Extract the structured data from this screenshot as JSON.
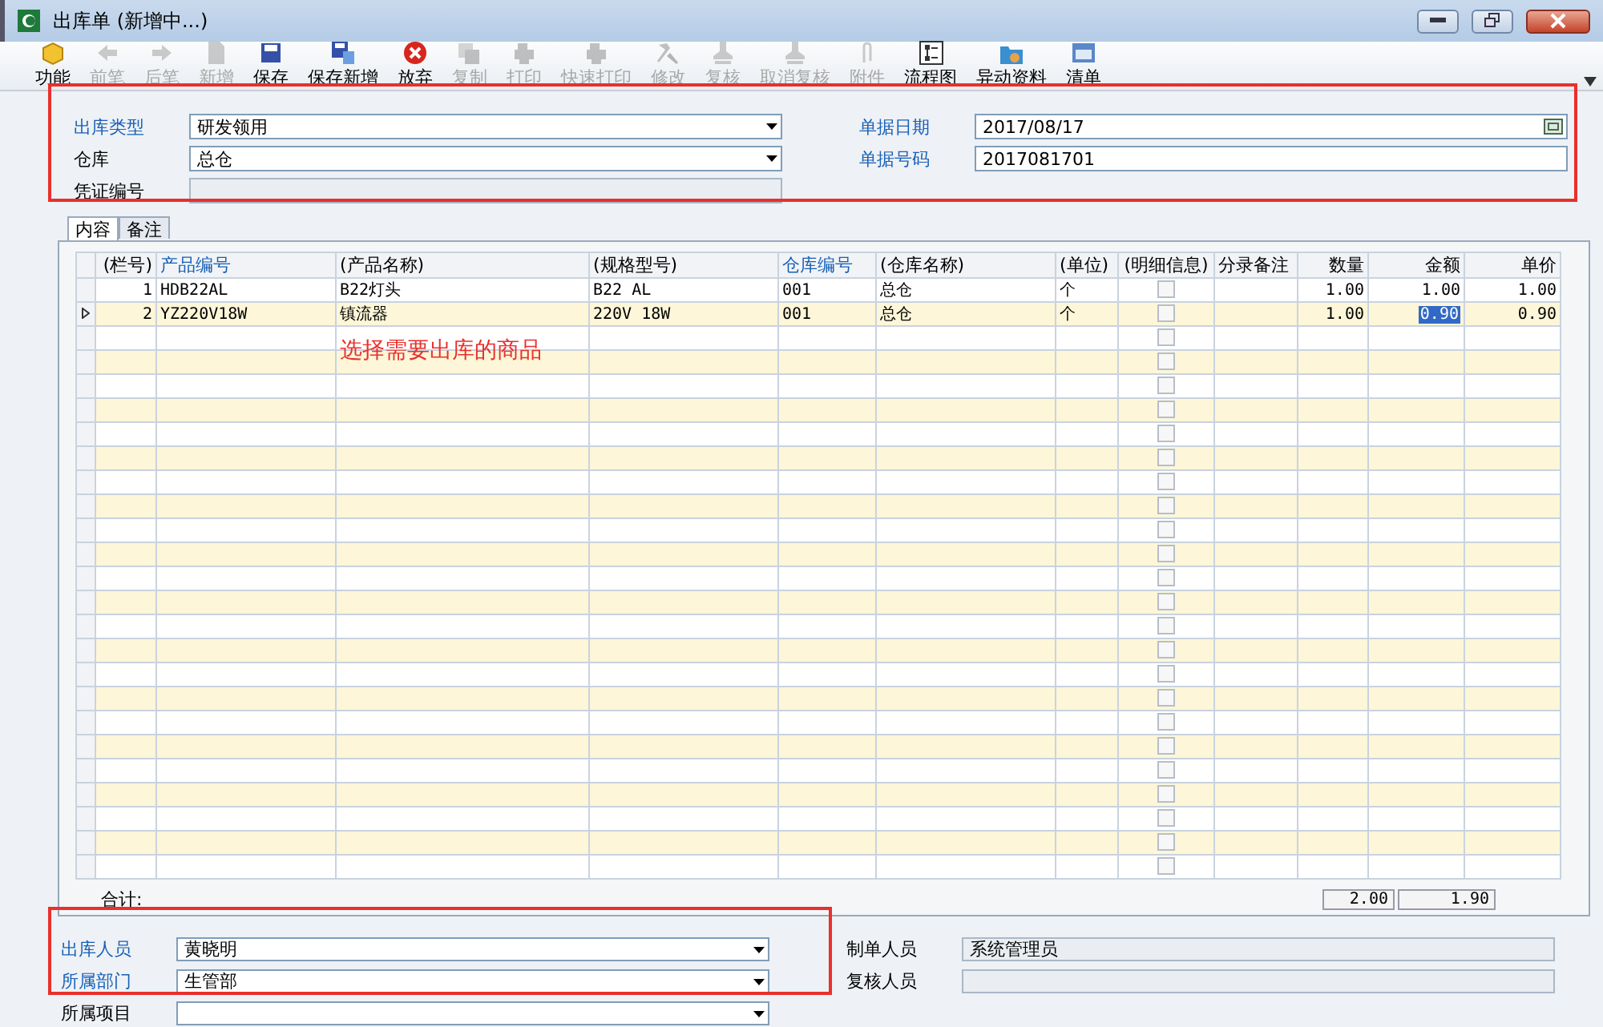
{
  "window": {
    "title": "出库单 (新增中...)"
  },
  "toolbar": [
    {
      "label": "功能",
      "disabled": false
    },
    {
      "label": "前笔",
      "disabled": true
    },
    {
      "label": "后笔",
      "disabled": true
    },
    {
      "label": "新增",
      "disabled": true
    },
    {
      "label": "保存",
      "disabled": false
    },
    {
      "label": "保存新增",
      "disabled": false
    },
    {
      "label": "放弃",
      "disabled": false
    },
    {
      "label": "复制",
      "disabled": true
    },
    {
      "label": "打印",
      "disabled": true
    },
    {
      "label": "快速打印",
      "disabled": true
    },
    {
      "label": "修改",
      "disabled": true
    },
    {
      "label": "复核",
      "disabled": true
    },
    {
      "label": "取消复核",
      "disabled": true
    },
    {
      "label": "附件",
      "disabled": true
    },
    {
      "label": "流程图",
      "disabled": false
    },
    {
      "label": "异动资料",
      "disabled": false
    },
    {
      "label": "清单",
      "disabled": false
    }
  ],
  "header_fields": [
    {
      "label": "出库类型",
      "value": "研发领用",
      "kind": "dropdown",
      "required": true,
      "readonly": false
    },
    {
      "label": "单据日期",
      "value": "2017/08/17",
      "kind": "date",
      "required": true,
      "readonly": false
    },
    {
      "label": "仓库",
      "value": "总仓",
      "kind": "dropdown",
      "required": false,
      "readonly": false
    },
    {
      "label": "单据号码",
      "value": "2017081701",
      "kind": "text",
      "required": true,
      "readonly": false
    },
    {
      "label": "凭证编号",
      "kind": "text",
      "required": false,
      "readonly": true
    }
  ],
  "tabs": [
    {
      "label": "内容",
      "selected": true
    },
    {
      "label": "备注",
      "selected": false
    }
  ],
  "table": {
    "columns": [
      {
        "label": "(栏号)",
        "lookup": false
      },
      {
        "label": "产品编号",
        "lookup": true
      },
      {
        "label": "(产品名称)",
        "lookup": false
      },
      {
        "label": "(规格型号)",
        "lookup": false
      },
      {
        "label": "仓库编号",
        "lookup": true
      },
      {
        "label": "(仓库名称)",
        "lookup": false
      },
      {
        "label": "(单位)",
        "lookup": false
      },
      {
        "label": "(明细信息)",
        "lookup": false
      },
      {
        "label": "分录备注",
        "lookup": false
      },
      {
        "label": "数量",
        "lookup": false
      },
      {
        "label": "金额",
        "lookup": false
      },
      {
        "label": "单价",
        "lookup": false
      }
    ],
    "rows": [
      {
        "selected": false,
        "checked": false,
        "cells": [
          "1",
          "HDB22AL",
          "B22灯头",
          "B22 AL",
          "001",
          "总仓",
          "个",
          "",
          "",
          "1.00",
          "1.00",
          "1.00"
        ]
      },
      {
        "selected": true,
        "checked": false,
        "cells": [
          "2",
          "YZ220V18W",
          "镇流器",
          "220V 18W",
          "001",
          "总仓",
          "个",
          "",
          "",
          "1.00",
          {
            "text": "0.90",
            "selected": true
          },
          "0.90"
        ]
      },
      {
        "selected": false,
        "checked": false
      },
      {
        "selected": false,
        "checked": false
      },
      {
        "selected": false,
        "checked": false
      },
      {
        "selected": false,
        "checked": false
      },
      {
        "selected": false,
        "checked": false
      },
      {
        "selected": false,
        "checked": false
      },
      {
        "selected": false,
        "checked": false
      },
      {
        "selected": false,
        "checked": false
      },
      {
        "selected": false,
        "checked": false
      },
      {
        "selected": false,
        "checked": false
      },
      {
        "selected": false,
        "checked": false
      },
      {
        "selected": false,
        "checked": false
      },
      {
        "selected": false,
        "checked": false
      },
      {
        "selected": false,
        "checked": false
      },
      {
        "selected": false,
        "checked": false
      },
      {
        "selected": false,
        "checked": false
      },
      {
        "selected": false,
        "checked": false
      },
      {
        "selected": false,
        "checked": false
      },
      {
        "selected": false,
        "checked": false
      },
      {
        "selected": false,
        "checked": false
      },
      {
        "selected": false,
        "checked": false
      },
      {
        "selected": false,
        "checked": false
      },
      {
        "selected": false,
        "checked": false
      }
    ],
    "totals": {
      "label": "合计:",
      "quantity": "2.00",
      "amount": "1.90"
    }
  },
  "footer_fields": [
    {
      "label": "出库人员",
      "value": "黄晓明",
      "kind": "dropdown",
      "required": true,
      "readonly": false
    },
    {
      "label": "制单人员",
      "value": "系统管理员",
      "kind": "text",
      "required": false,
      "readonly": true
    },
    {
      "label": "所属部门",
      "value": "生管部",
      "kind": "dropdown",
      "required": true,
      "readonly": false
    },
    {
      "label": "复核人员",
      "kind": "text",
      "required": false,
      "readonly": true
    },
    {
      "label": "所属项目",
      "kind": "dropdown",
      "required": false,
      "readonly": false
    }
  ],
  "annotations": [
    {
      "text": "选择需要出库的商品"
    }
  ]
}
